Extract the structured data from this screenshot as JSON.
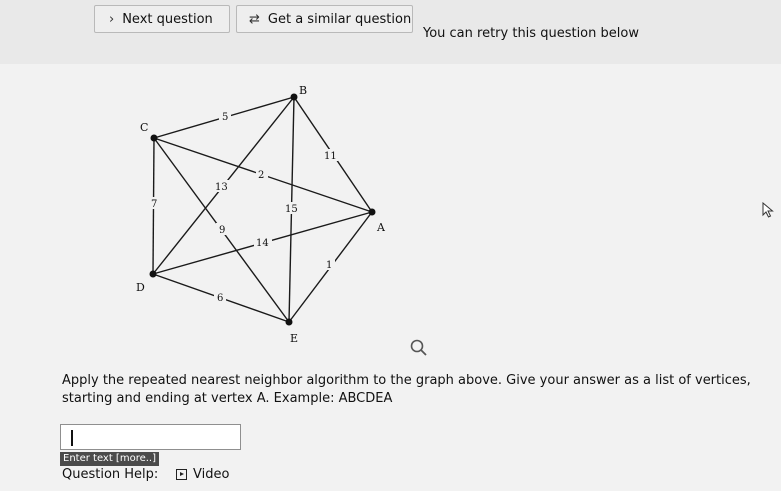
{
  "toolbar": {
    "next_label": "Next question",
    "similar_label": "Get a similar question",
    "retry_text": "You can retry this question below"
  },
  "graph": {
    "vertices": {
      "A": "A",
      "B": "B",
      "C": "C",
      "D": "D",
      "E": "E"
    },
    "edges": [
      {
        "from": "C",
        "to": "B",
        "weight": "5"
      },
      {
        "from": "B",
        "to": "A",
        "weight": "11"
      },
      {
        "from": "C",
        "to": "A",
        "weight": "2"
      },
      {
        "from": "B",
        "to": "D",
        "weight": "13"
      },
      {
        "from": "C",
        "to": "D",
        "weight": "7"
      },
      {
        "from": "B",
        "to": "E",
        "weight": "15"
      },
      {
        "from": "C",
        "to": "E",
        "weight": "9"
      },
      {
        "from": "D",
        "to": "A",
        "weight": "14"
      },
      {
        "from": "E",
        "to": "A",
        "weight": "1"
      },
      {
        "from": "D",
        "to": "E",
        "weight": "6"
      }
    ]
  },
  "question": {
    "text": "Apply the repeated nearest neighbor algorithm to the graph above. Give your answer as a list of vertices, starting and ending at vertex A. Example: ABCDEA",
    "answer_value": "",
    "enter_text_label": "Enter text [more..]"
  },
  "help": {
    "label": "Question Help:",
    "video_label": "Video"
  },
  "icons": {
    "next": "chevron-right-icon",
    "similar": "repeat-icon",
    "search": "search-icon",
    "video": "video-play-icon",
    "cursor": "mouse-pointer-icon"
  }
}
